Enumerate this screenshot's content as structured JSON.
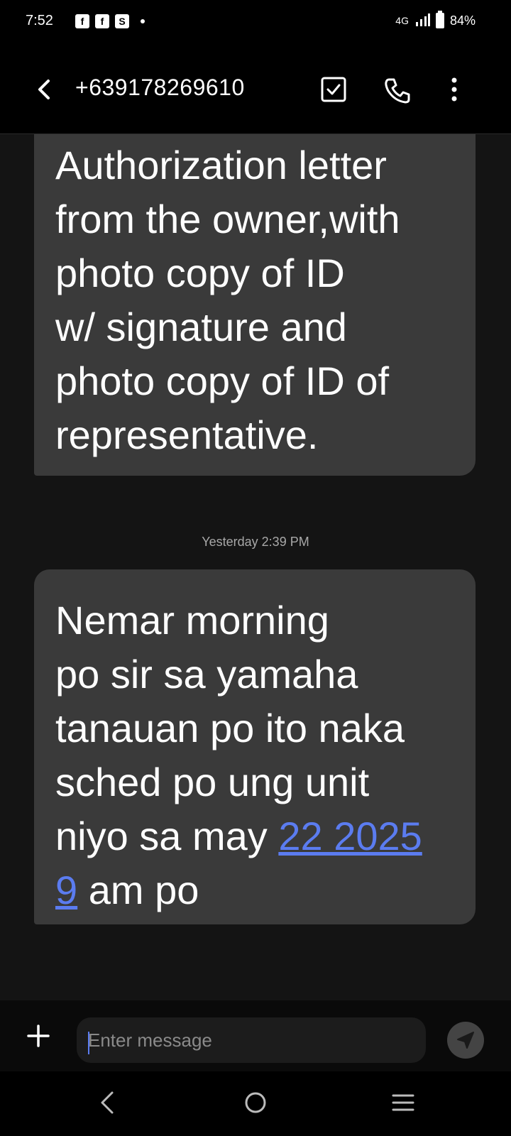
{
  "status_bar": {
    "time": "7:52",
    "notifications": [
      {
        "icon": "facebook-icon",
        "glyph": "f"
      },
      {
        "icon": "facebook-icon",
        "glyph": "f"
      },
      {
        "icon": "s-app-icon",
        "glyph": "S"
      }
    ],
    "network": "4G",
    "battery": "84%"
  },
  "header": {
    "contact": "+639178269610",
    "icons": [
      "back-icon",
      "checkbox-icon",
      "phone-icon",
      "more-vert-icon"
    ]
  },
  "messages": [
    {
      "direction": "incoming",
      "text": "Authorization letter\nfrom the owner,with\nphoto copy of ID\nw/ signature and\nphoto copy of ID of\nrepresentative."
    },
    {
      "direction": "incoming",
      "timestamp": "Yesterday 2:39 PM",
      "text_before_link": "Nemar morning\npo sir sa yamaha\ntanauan po ito naka\nsched po ung unit\nniyo sa may ",
      "link_line1": "22 2025",
      "link_line2": "9",
      "text_after_link": " am po"
    }
  ],
  "composer": {
    "placeholder": "Enter message"
  },
  "colors": {
    "background": "#000000",
    "conversation_bg": "#141414",
    "bubble": "#3a3a3a",
    "link": "#5b7cf0",
    "timestamp": "#a8a8a8"
  }
}
